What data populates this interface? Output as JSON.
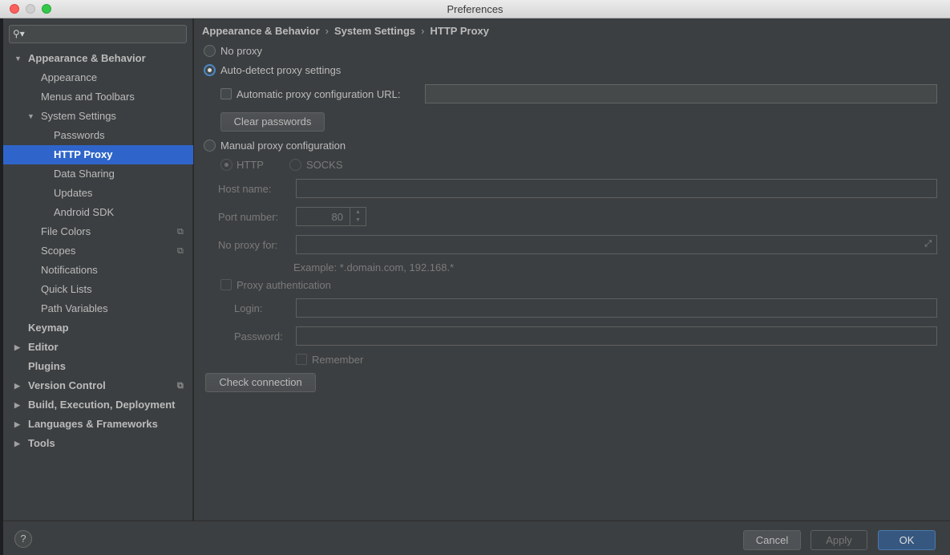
{
  "window": {
    "title": "Preferences"
  },
  "sidebar": {
    "search_placeholder": "",
    "items": [
      {
        "label": "Appearance & Behavior",
        "bold": true,
        "arrow": "▼"
      },
      {
        "label": "Appearance"
      },
      {
        "label": "Menus and Toolbars"
      },
      {
        "label": "System Settings",
        "arrow": "▼"
      },
      {
        "label": "Passwords"
      },
      {
        "label": "HTTP Proxy",
        "selected": true
      },
      {
        "label": "Data Sharing"
      },
      {
        "label": "Updates"
      },
      {
        "label": "Android SDK"
      },
      {
        "label": "File Colors",
        "copy_icon": true
      },
      {
        "label": "Scopes",
        "copy_icon": true
      },
      {
        "label": "Notifications"
      },
      {
        "label": "Quick Lists"
      },
      {
        "label": "Path Variables"
      },
      {
        "label": "Keymap",
        "bold": true
      },
      {
        "label": "Editor",
        "bold": true,
        "arrow": "▶"
      },
      {
        "label": "Plugins",
        "bold": true
      },
      {
        "label": "Version Control",
        "bold": true,
        "arrow": "▶",
        "copy_icon": true
      },
      {
        "label": "Build, Execution, Deployment",
        "bold": true,
        "arrow": "▶"
      },
      {
        "label": "Languages & Frameworks",
        "bold": true,
        "arrow": "▶"
      },
      {
        "label": "Tools",
        "bold": true,
        "arrow": "▶"
      }
    ]
  },
  "breadcrumb": {
    "parts": [
      "Appearance & Behavior",
      "System Settings",
      "HTTP Proxy"
    ],
    "separator": "›"
  },
  "proxy": {
    "no_proxy_label": "No proxy",
    "auto_detect_label": "Auto-detect proxy settings",
    "auto_config_url_label": "Automatic proxy configuration URL:",
    "auto_config_url_value": "",
    "clear_passwords_label": "Clear passwords",
    "manual_label": "Manual proxy configuration",
    "http_label": "HTTP",
    "socks_label": "SOCKS",
    "host_name_label": "Host name:",
    "host_name_value": "",
    "port_number_label": "Port number:",
    "port_number_value": "80",
    "no_proxy_for_label": "No proxy for:",
    "no_proxy_for_value": "",
    "example_text": "Example: *.domain.com, 192.168.*",
    "proxy_auth_label": "Proxy authentication",
    "login_label": "Login:",
    "login_value": "",
    "password_label": "Password:",
    "password_value": "",
    "remember_label": "Remember",
    "check_connection_label": "Check connection",
    "selected_mode": "auto-detect"
  },
  "footer": {
    "help_label": "?",
    "cancel_label": "Cancel",
    "apply_label": "Apply",
    "ok_label": "OK"
  },
  "colors": {
    "accent": "#2f65ca",
    "ok_button": "#365880",
    "panel": "#3c3f41"
  }
}
